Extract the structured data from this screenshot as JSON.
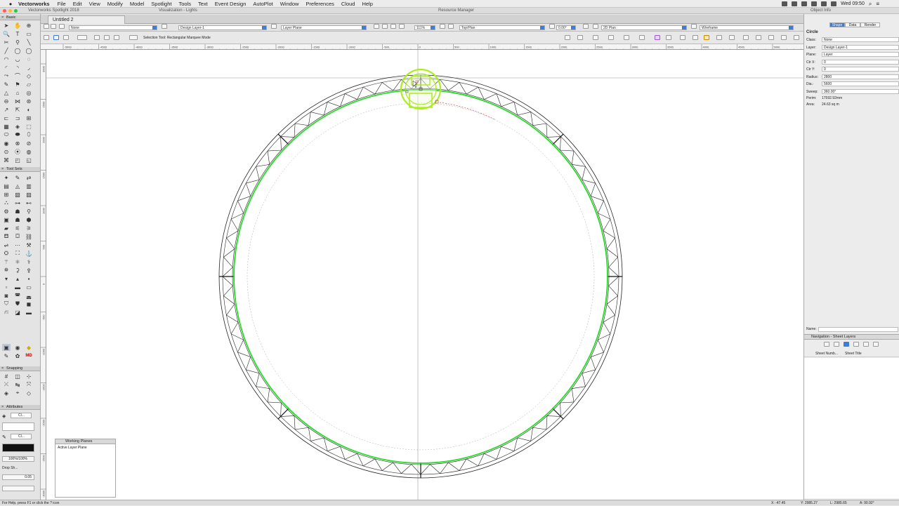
{
  "menubar": {
    "app": "Vectorworks",
    "items": [
      "File",
      "Edit",
      "View",
      "Modify",
      "Model",
      "Spotlight",
      "Tools",
      "Text",
      "Event Design",
      "AutoPlot",
      "Window",
      "Preferences",
      "Cloud",
      "Help"
    ],
    "clock": "Wed 09:50"
  },
  "titles": {
    "main": "Vectorworks Spotlight 2018",
    "viz": "Visualization - Lights",
    "resource": "Resource Manager",
    "object_info": "Object Info"
  },
  "tab": {
    "label": "Untitled 2"
  },
  "viewbar": {
    "class": "None",
    "layer": "Design Layer-1",
    "plane": "Layer Plane",
    "zoom": "111%",
    "view": "Top/Plan",
    "angle": "0.00°",
    "render_view": "2D Plan",
    "render_mode": "Wireframe"
  },
  "modebar": {
    "message": "Selection Tool: Rectangular Marquee Mode"
  },
  "hruler": [
    "-5000",
    "-4500",
    "-4000",
    "-3500",
    "-3000",
    "-2500",
    "-2000",
    "-1500",
    "-1000",
    "-500",
    "0",
    "500",
    "1000",
    "1500",
    "2000",
    "2500",
    "3000",
    "3500",
    "4000",
    "4500",
    "5000"
  ],
  "vruler": [
    "3000",
    "2500",
    "2000",
    "1500",
    "1000",
    "500",
    "0",
    "-500",
    "-1000",
    "-1500",
    "-2000",
    "-2500",
    "-3000"
  ],
  "palettes": {
    "basic": "Basic",
    "toolsets": "Tool Sets",
    "snapping": "Snapping",
    "attributes": "Attributes",
    "opacity": "100%/100%",
    "drop_shadow": "Drop Sh...",
    "line_weight": "0.05",
    "md_label": "MD"
  },
  "object_info": {
    "tabs": [
      "Shape",
      "Data",
      "Render"
    ],
    "type": "Circle",
    "rows": [
      {
        "label": "Class:",
        "value": "None"
      },
      {
        "label": "Layer:",
        "value": "Design Layer-1"
      },
      {
        "label": "Plane:",
        "value": "Layer"
      },
      {
        "label": "Ctr X:",
        "value": "0"
      },
      {
        "label": "Ctr Y:",
        "value": "0"
      },
      {
        "label": "Radius:",
        "value": "2800"
      },
      {
        "label": "Dia.:",
        "value": "5600"
      },
      {
        "label": "Sweep:",
        "value": "360.00°"
      }
    ],
    "perim_label": "Perim:",
    "perim": "17592.92mm",
    "area_label": "Area:",
    "area": "24.63 sq m",
    "name_label": "Name:"
  },
  "navigation": {
    "title": "Navigation - Sheet Layers",
    "col1": "Sheet Numb...",
    "col2": "Sheet Title"
  },
  "working_planes": {
    "title": "Working Planes",
    "item": "Active Layer Plane"
  },
  "status": {
    "help": "For Help, press F1 or click the ? icon",
    "x": "X: -47.45",
    "y": "Y: 2985.27",
    "l": "L: 2985.65",
    "a": "A: 90.92°"
  },
  "colors": {
    "accent": "#3b7ddb",
    "truss_green": "#22dd22",
    "select_green": "#aaee22"
  }
}
